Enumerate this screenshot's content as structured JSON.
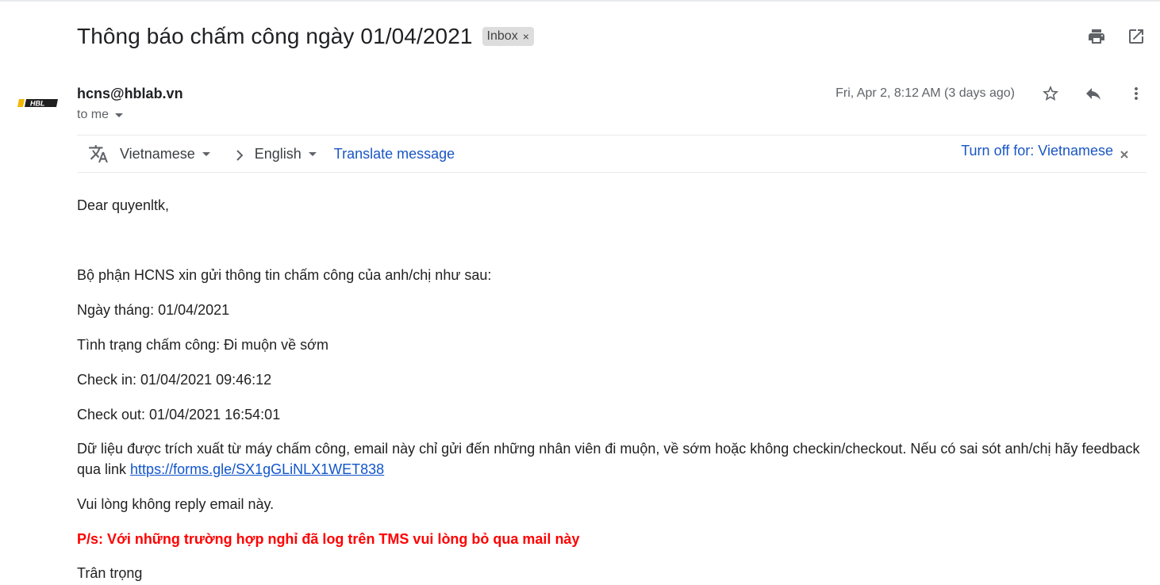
{
  "email": {
    "subject": "Thông báo chấm công ngày 01/04/2021",
    "label": "Inbox",
    "label_remove": "×",
    "sender": "hcns@hblab.vn",
    "recipient": "to me",
    "date": "Fri, Apr 2, 8:12 AM (3 days ago)",
    "avatar_text": "HBL"
  },
  "translate": {
    "from_lang": "Vietnamese",
    "to_lang": "English",
    "translate_link": "Translate message",
    "turn_off": "Turn off for: Vietnamese"
  },
  "body": {
    "greeting": "Dear quyenltk,",
    "intro": "Bộ phận HCNS xin gửi thông tin chấm công của anh/chị như sau:",
    "date_line": "Ngày tháng: 01/04/2021",
    "status_line": "Tình trạng chấm công: Đi muộn về sớm",
    "checkin": "Check in: 01/04/2021 09:46:12",
    "checkout": "Check out: 01/04/2021 16:54:01",
    "data_note_prefix": "Dữ liệu được trích xuất từ máy chấm công, email này chỉ gửi đến những nhân viên đi muộn, về sớm hoặc không checkin/checkout. Nếu có sai sót anh/chị hãy feedback qua link ",
    "feedback_link": "https://forms.gle/SX1gGLiNLX1WET838",
    "noreply": "Vui lòng không reply email này.",
    "ps": "P/s: Với những trường hợp nghỉ đã log trên TMS vui lòng bỏ qua mail này",
    "regards": "Trân trọng"
  },
  "colors": {
    "link": "#1a56c5",
    "warning": "#ff0000",
    "avatar_accent": "#f2b705"
  }
}
